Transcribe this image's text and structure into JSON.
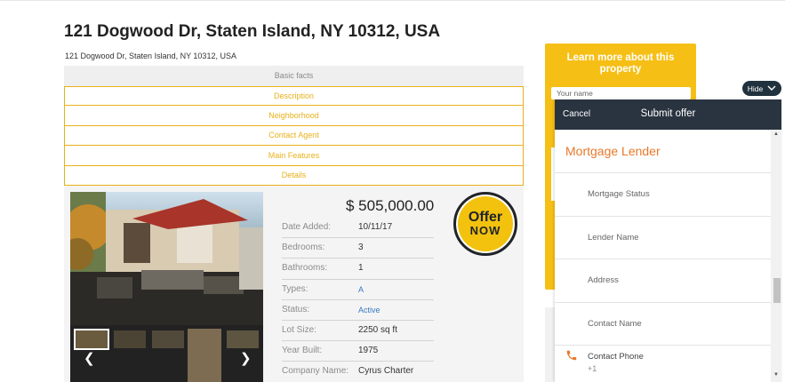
{
  "property": {
    "title": "121 Dogwood Dr, Staten Island, NY 10312, USA",
    "address": "121 Dogwood Dr, Staten Island, NY 10312, USA"
  },
  "tabs": [
    "Basic facts",
    "Description",
    "Neighborhood",
    "Contact Agent",
    "Main Features",
    "Details"
  ],
  "listing": {
    "price": "$ 505,000.00",
    "facts": [
      {
        "key": "Date Added:",
        "value": "10/11/17",
        "link": false
      },
      {
        "key": "Bedrooms:",
        "value": "3",
        "link": false
      },
      {
        "key": "Bathrooms:",
        "value": "1",
        "link": false
      },
      {
        "key": "Types:",
        "value": "A",
        "link": true
      },
      {
        "key": "Status:",
        "value": "Active",
        "link": true
      },
      {
        "key": "Lot Size:",
        "value": "2250 sq ft",
        "link": false
      },
      {
        "key": "Year Built:",
        "value": "1975",
        "link": false
      },
      {
        "key": "Company Name:",
        "value": "Cyrus Charter",
        "link": false
      }
    ],
    "badge_line1": "Offer",
    "badge_line2": "NOW",
    "prev_icon": "chevron-left-icon",
    "next_icon": "chevron-right-icon"
  },
  "learn_more": {
    "heading": "Learn more about this property",
    "name_placeholder": "Your name"
  },
  "hide_button": {
    "label": "Hide",
    "icon": "chevron-down-icon"
  },
  "offer_panel": {
    "cancel": "Cancel",
    "title": "Submit offer",
    "section_title": "Mortgage Lender",
    "fields": [
      "Mortgage Status",
      "Lender Name",
      "Address",
      "Contact Name"
    ],
    "phone_label": "Contact Phone",
    "phone_prefix": "+1"
  },
  "colors": {
    "accent_yellow": "#f6bf16",
    "tab_gold": "#e8b11a",
    "panel_header": "#2a3440",
    "section_orange": "#e8782a",
    "link_blue": "#3a79c0"
  }
}
